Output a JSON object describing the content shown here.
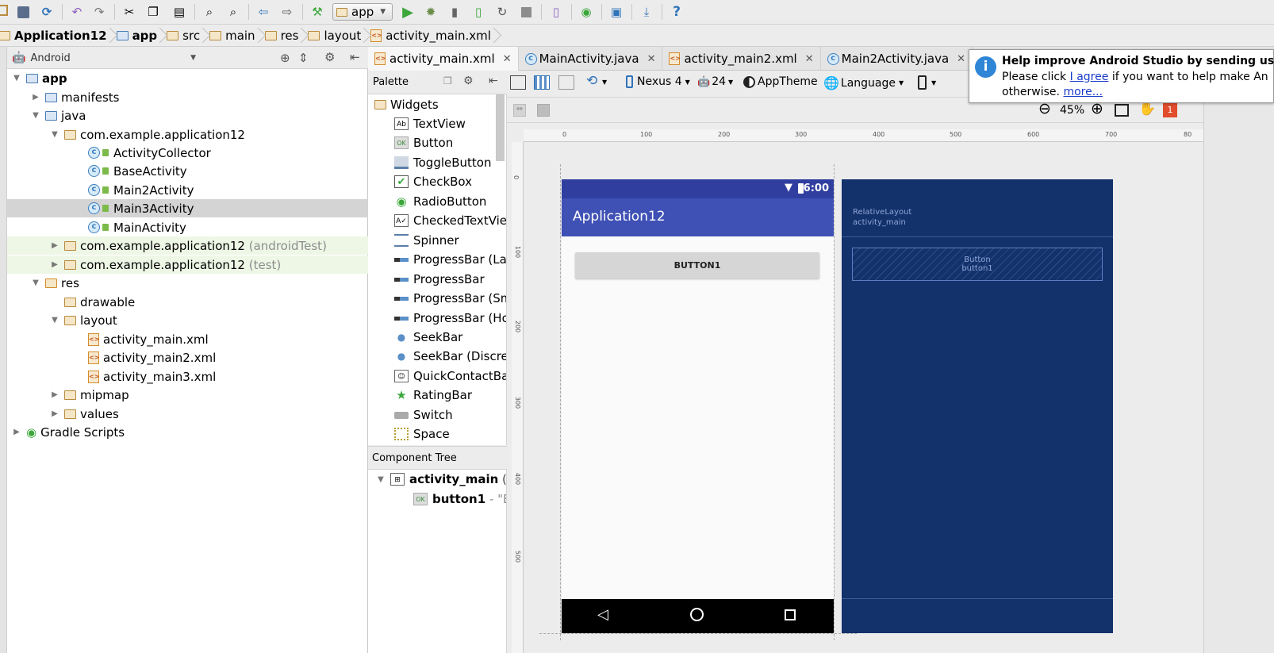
{
  "toolbar": {
    "run_config": "app",
    "icons": [
      "open-folder-icon",
      "save-icon",
      "sync-icon",
      "undo-icon",
      "redo-icon",
      "cut-icon",
      "copy-icon",
      "paste-icon",
      "find-icon",
      "replace-icon",
      "back-icon",
      "forward-icon",
      "make-project-icon",
      "run-icon",
      "debug-icon",
      "profile-icon",
      "apply-changes-icon",
      "restart-activity-icon",
      "stop-icon",
      "avd-manager-icon",
      "gradle-sync-icon",
      "project-structure-icon",
      "sdk-manager-icon",
      "help-icon"
    ]
  },
  "breadcrumb": [
    "Application12",
    "app",
    "src",
    "main",
    "res",
    "layout",
    "activity_main.xml"
  ],
  "project_view": {
    "mode": "Android",
    "tree": [
      {
        "label": "app",
        "bold": true
      },
      {
        "label": "manifests"
      },
      {
        "label": "java"
      },
      {
        "label": "com.example.application12"
      },
      {
        "label": "ActivityCollector"
      },
      {
        "label": "BaseActivity"
      },
      {
        "label": "Main2Activity"
      },
      {
        "label": "Main3Activity",
        "selected": true
      },
      {
        "label": "MainActivity"
      },
      {
        "label": "com.example.application12",
        "suffix": "(androidTest)"
      },
      {
        "label": "com.example.application12",
        "suffix": "(test)"
      },
      {
        "label": "res"
      },
      {
        "label": "drawable"
      },
      {
        "label": "layout"
      },
      {
        "label": "activity_main.xml"
      },
      {
        "label": "activity_main2.xml"
      },
      {
        "label": "activity_main3.xml"
      },
      {
        "label": "mipmap"
      },
      {
        "label": "values"
      },
      {
        "label": "Gradle Scripts"
      }
    ]
  },
  "tabs": [
    {
      "label": "activity_main.xml",
      "active": true
    },
    {
      "label": "MainActivity.java"
    },
    {
      "label": "activity_main2.xml"
    },
    {
      "label": "Main2Activity.java"
    }
  ],
  "palette": {
    "title": "Palette",
    "group": "Widgets",
    "items": [
      "TextView",
      "Button",
      "ToggleButton",
      "CheckBox",
      "RadioButton",
      "CheckedTextViev",
      "Spinner",
      "ProgressBar (Lar",
      "ProgressBar",
      "ProgressBar (Sm",
      "ProgressBar (Ho",
      "SeekBar",
      "SeekBar (Discret",
      "QuickContactBad",
      "RatingBar",
      "Switch",
      "Space"
    ]
  },
  "component_tree": {
    "title": "Component Tree",
    "root": "activity_main",
    "root_suffix": "(R",
    "child": "button1",
    "child_suffix": "- \"Bu"
  },
  "design_toolbar": {
    "device": "Nexus 4",
    "api": "24",
    "theme": "AppTheme",
    "language": "Language",
    "zoom": "45%",
    "error_count": "1"
  },
  "ruler": {
    "h_ticks": [
      "0",
      "100",
      "200",
      "300",
      "400",
      "500",
      "600",
      "700",
      "80"
    ],
    "v_ticks": [
      "0",
      "100",
      "200",
      "300",
      "400",
      "500"
    ]
  },
  "device_preview": {
    "status_time": "6:00",
    "app_title": "Application12",
    "button_label": "BUTTON1"
  },
  "blueprint": {
    "layout_type": "RelativeLayout",
    "layout_id": "activity_main",
    "button_type": "Button",
    "button_id": "button1"
  },
  "help_popup": {
    "title": "Help improve Android Studio by sending us",
    "line1_prefix": "Please click",
    "link_agree": "I agree",
    "line1_suffix": "if you want to help make An",
    "line2_prefix": "otherwise.",
    "link_more": "more..."
  },
  "colors": {
    "app_bar": "#3f51b5",
    "status_bar": "#303f9f",
    "blueprint_bg": "#13316b",
    "selection": "#d4d4d4",
    "run_green": "#3ba73b"
  }
}
